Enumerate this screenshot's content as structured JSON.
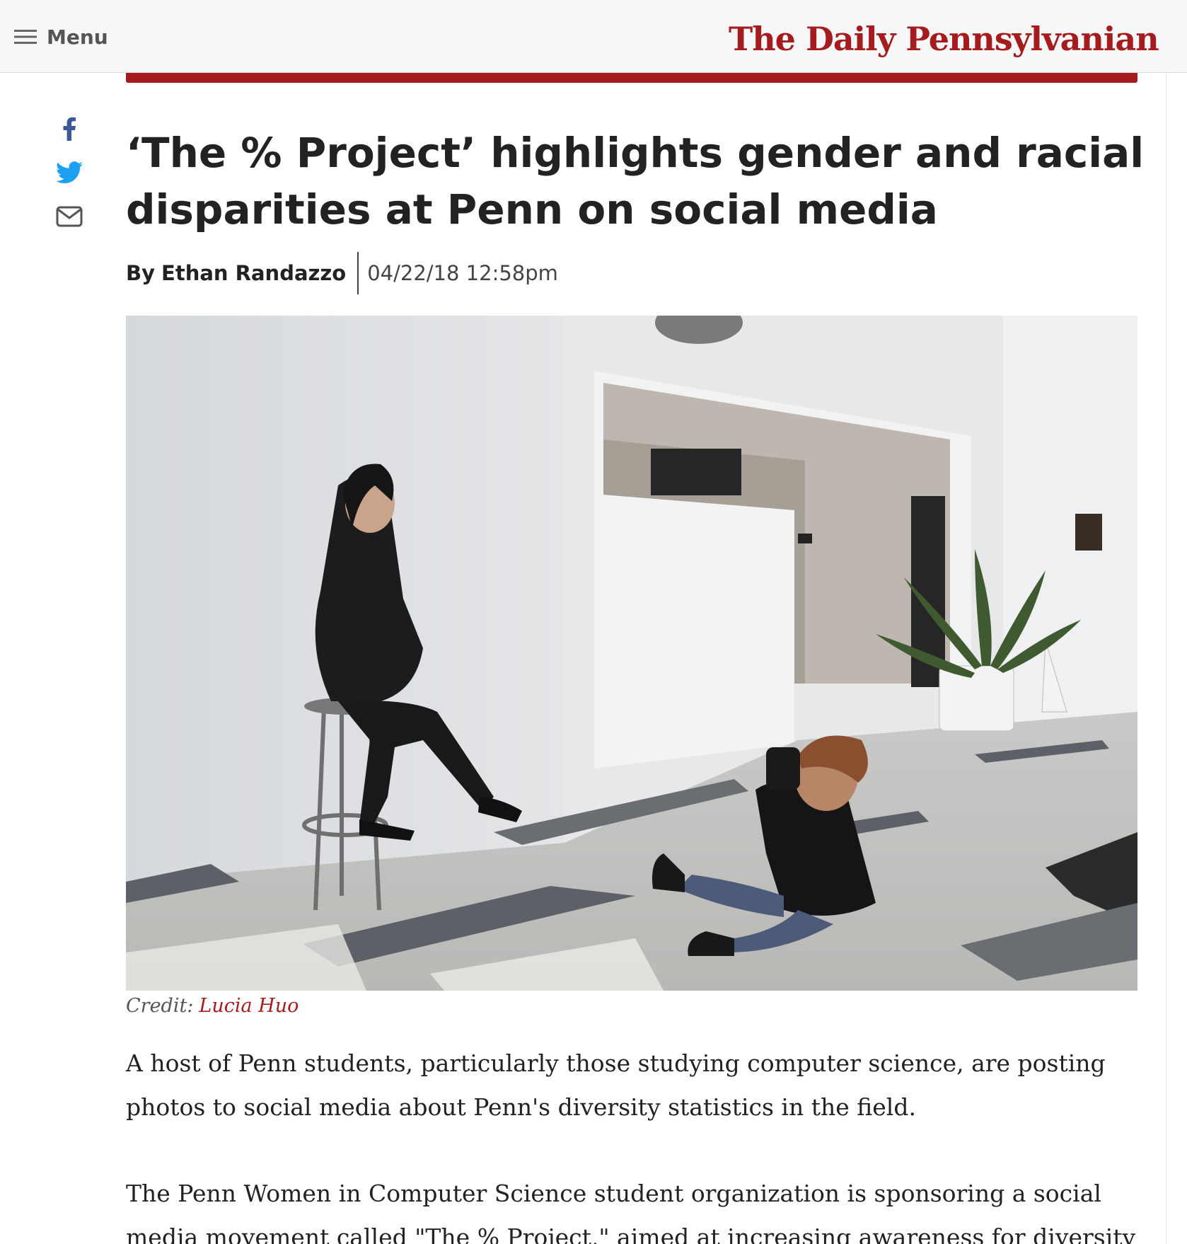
{
  "header": {
    "menu_label": "Menu",
    "masthead": "The Daily Pennsylvanian",
    "brand_color": "#a51c1f"
  },
  "share": {
    "icons": [
      "facebook-icon",
      "twitter-icon",
      "mail-icon"
    ],
    "facebook_color": "#3b5998",
    "twitter_color": "#1da1f2"
  },
  "article": {
    "headline": "‘The % Project’ highlights gender and racial disparities at Penn on social media",
    "by_prefix": "By",
    "author": "Ethan Randazzo",
    "date": "04/22/18 12:58pm",
    "photo_credit_label": "Credit:",
    "photo_credit_name": "Lucia Huo",
    "paragraphs": [
      "A host of Penn students, particularly those studying computer science, are posting photos to social media about Penn's diversity statistics in the field.",
      "The Penn Women in Computer Science student organization is sponsoring a social media movement called \"The % Project,\" aimed at increasing awareness for diversity"
    ]
  }
}
